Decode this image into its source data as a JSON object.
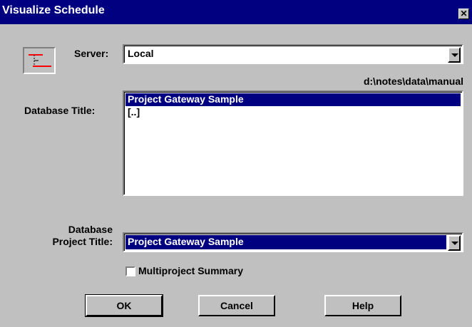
{
  "window": {
    "title": "Visualize Schedule",
    "close_glyph": "✕"
  },
  "server": {
    "label": "Server:",
    "value": "Local"
  },
  "path": "d:\\notes\\data\\manual",
  "database": {
    "label": "Database Title:",
    "items": [
      "Project Gateway Sample",
      "[..]"
    ],
    "selected_index": 0
  },
  "project": {
    "label_line1": "Database",
    "label_line2": "Project Title:",
    "value": "Project Gateway Sample"
  },
  "multiproject": {
    "label": "Multiproject Summary",
    "checked": false
  },
  "buttons": {
    "ok": "OK",
    "cancel": "Cancel",
    "help": "Help"
  },
  "colors": {
    "titlebar": "#000080",
    "selection": "#000080",
    "face": "#c0c0c0",
    "icon_accent": "#ff0000"
  },
  "icons": {
    "app": "schedule-gantt-icon"
  }
}
